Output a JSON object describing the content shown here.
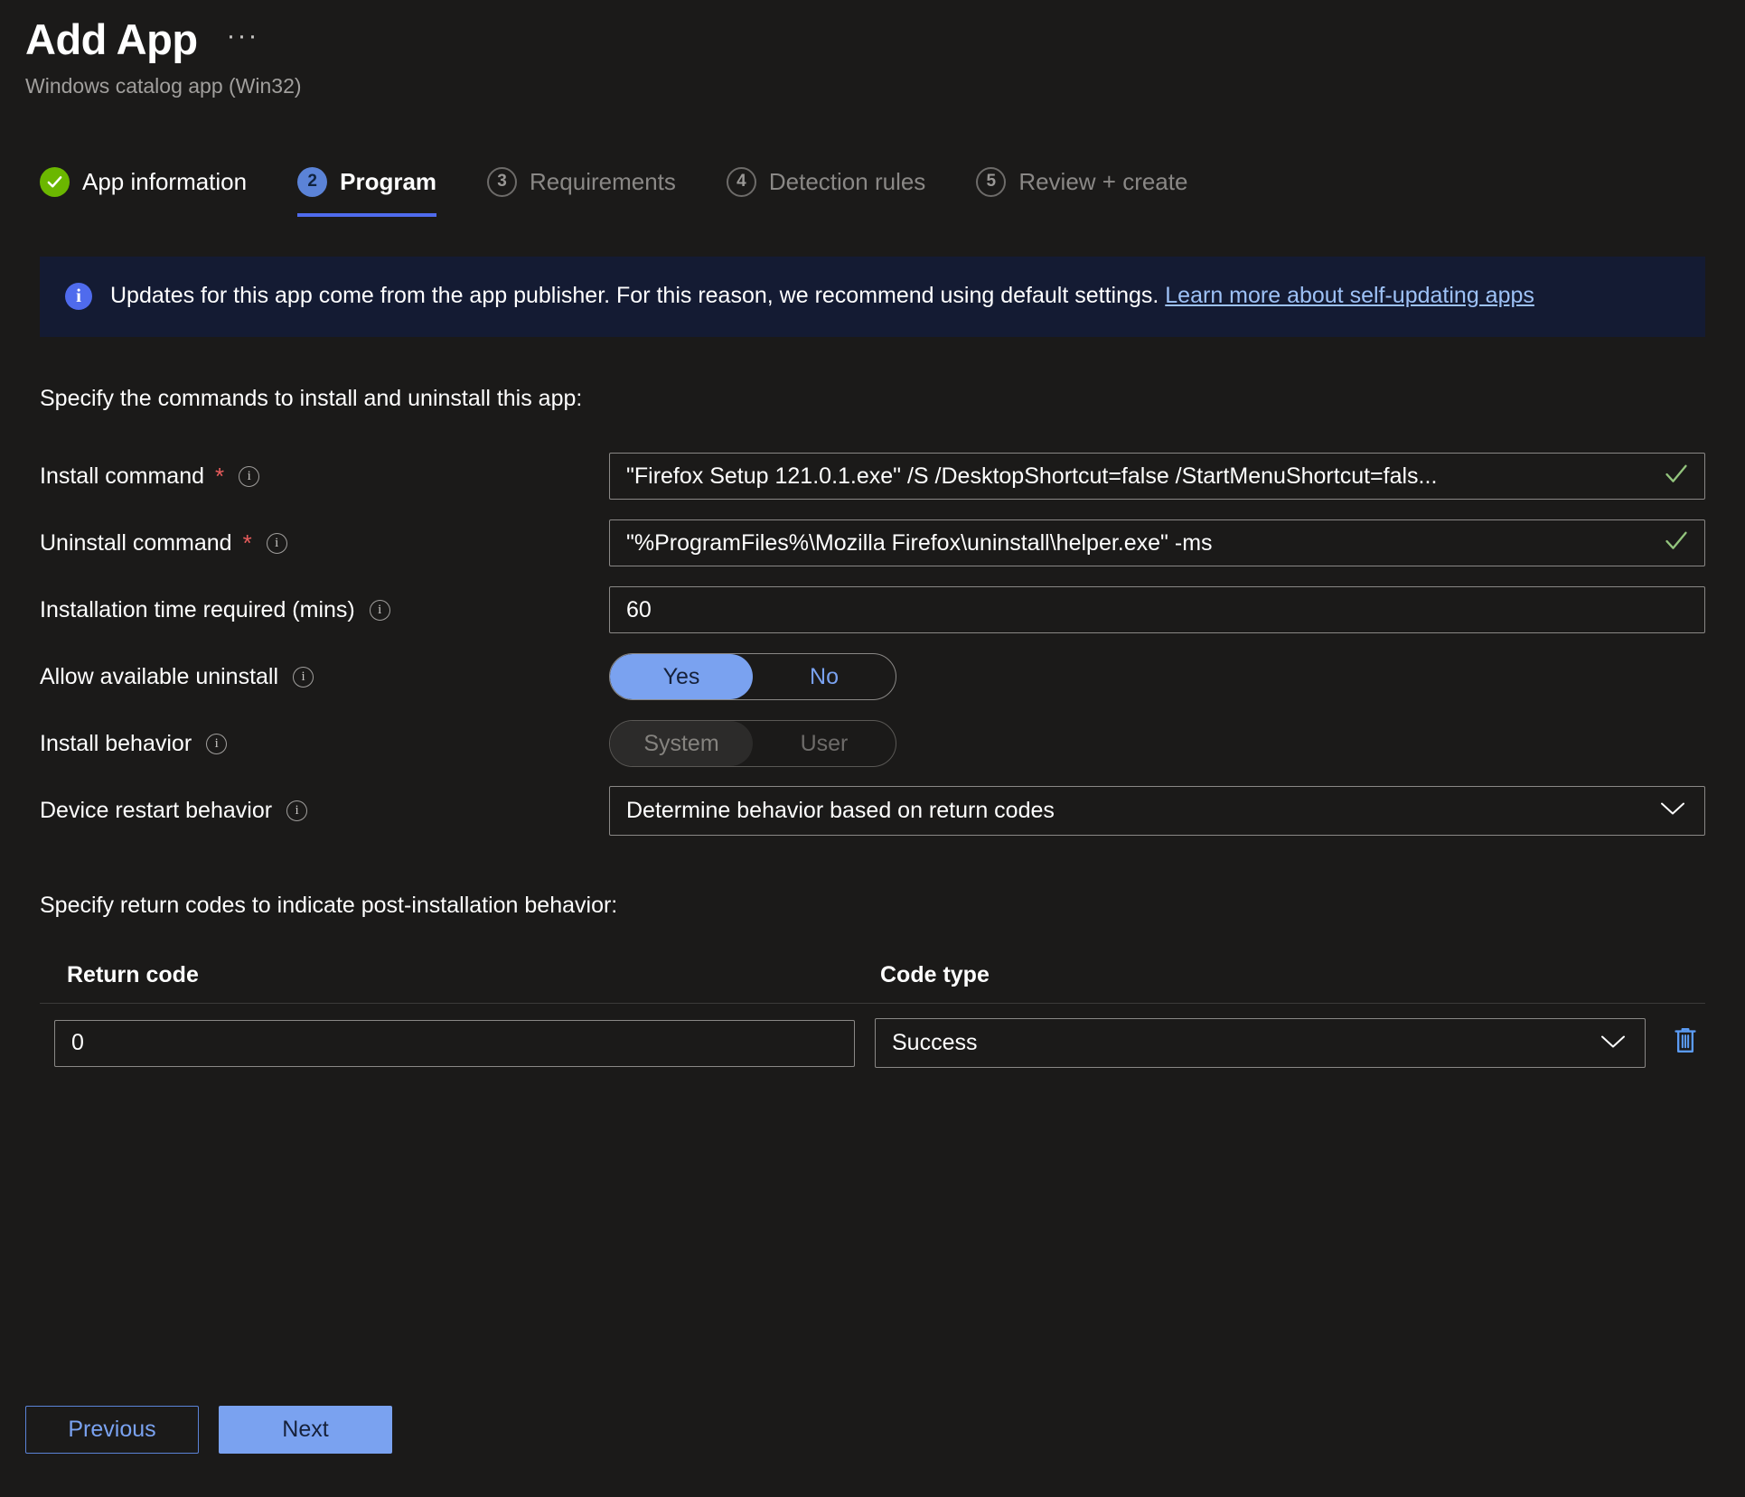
{
  "header": {
    "title": "Add App",
    "more_menu": "···",
    "subtitle": "Windows catalog app (Win32)"
  },
  "steps": [
    {
      "number": "1",
      "label": "App information",
      "state": "done",
      "icon": "check-icon"
    },
    {
      "number": "2",
      "label": "Program",
      "state": "active"
    },
    {
      "number": "3",
      "label": "Requirements",
      "state": "todo"
    },
    {
      "number": "4",
      "label": "Detection rules",
      "state": "todo"
    },
    {
      "number": "5",
      "label": "Review + create",
      "state": "todo"
    }
  ],
  "banner": {
    "icon": "info-icon",
    "text_before_link": "Updates for this app come from the app publisher. For this reason, we recommend using default settings. ",
    "link_text": "Learn more about self-updating apps"
  },
  "form": {
    "section_heading": "Specify the commands to install and uninstall this app:",
    "install_command": {
      "label": "Install command",
      "required_marker": "*",
      "value": "\"Firefox Setup 121.0.1.exe\" /S /DesktopShortcut=false /StartMenuShortcut=fals...",
      "valid_icon": "checkmark-icon"
    },
    "uninstall_command": {
      "label": "Uninstall command",
      "required_marker": "*",
      "value": "\"%ProgramFiles%\\Mozilla Firefox\\uninstall\\helper.exe\" -ms",
      "valid_icon": "checkmark-icon"
    },
    "installation_time": {
      "label": "Installation time required (mins)",
      "value": "60"
    },
    "allow_available_uninstall": {
      "label": "Allow available uninstall",
      "options": [
        "Yes",
        "No"
      ],
      "selected": "Yes",
      "disabled": false
    },
    "install_behavior": {
      "label": "Install behavior",
      "options": [
        "System",
        "User"
      ],
      "selected": "System",
      "disabled": true
    },
    "device_restart_behavior": {
      "label": "Device restart behavior",
      "value": "Determine behavior based on return codes",
      "chevron": "chevron-down-icon"
    }
  },
  "return_codes": {
    "section_heading": "Specify return codes to indicate post-installation behavior:",
    "columns": [
      "Return code",
      "Code type"
    ],
    "rows": [
      {
        "code": "0",
        "type": "Success",
        "delete_icon": "trash-icon"
      }
    ]
  },
  "footer": {
    "previous_label": "Previous",
    "next_label": "Next"
  },
  "colors": {
    "background": "#1b1a19",
    "accent_blue": "#7aa2f0",
    "active_step": "#5b83d7",
    "done_green": "#6bb700",
    "required_red": "#e85c5c",
    "banner_bg": "#141b33",
    "link_blue": "#9ec2f7"
  }
}
